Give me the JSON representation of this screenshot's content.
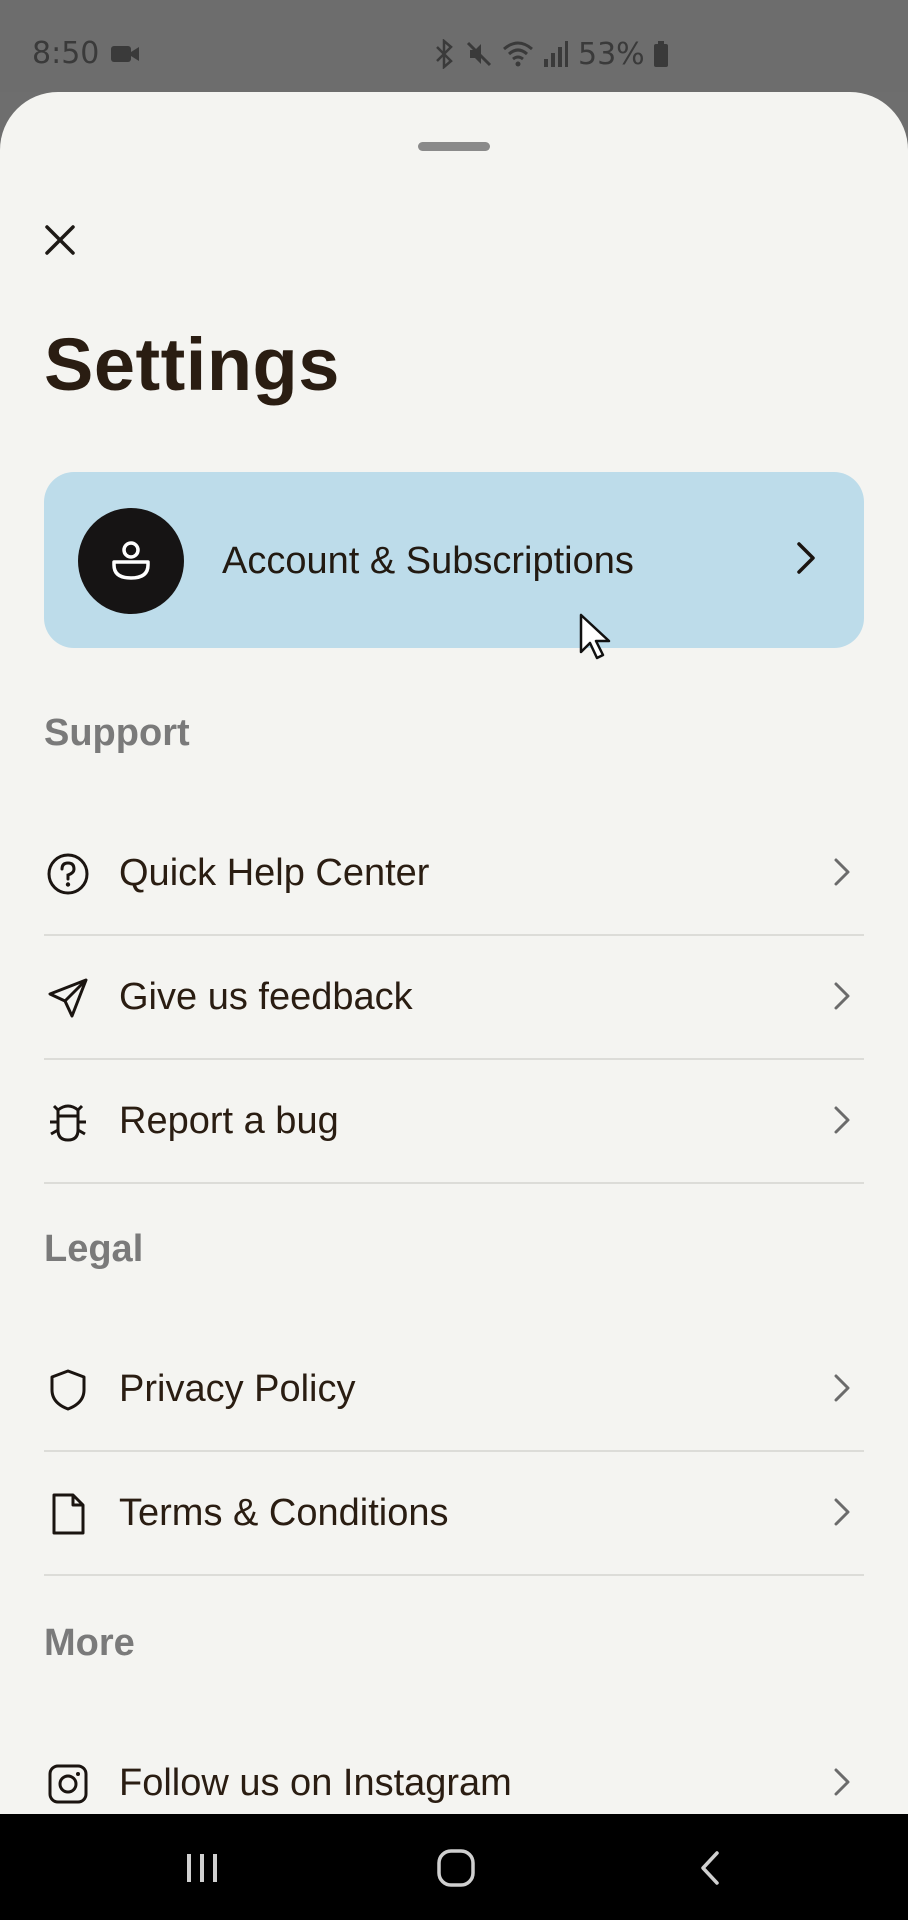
{
  "status_bar": {
    "time": "8:50",
    "battery_text": "53%",
    "icons": [
      "video-camera-icon",
      "bluetooth-icon",
      "mute-icon",
      "wifi-icon",
      "signal-icon",
      "battery-icon"
    ]
  },
  "header": {
    "title": "Settings"
  },
  "account": {
    "label": "Account & Subscriptions",
    "icon": "user-icon"
  },
  "sections": {
    "support": {
      "title": "Support",
      "items": [
        {
          "label": "Quick Help Center",
          "icon": "help-circle-icon"
        },
        {
          "label": "Give us feedback",
          "icon": "send-icon"
        },
        {
          "label": "Report a bug",
          "icon": "bug-icon"
        }
      ]
    },
    "legal": {
      "title": "Legal",
      "items": [
        {
          "label": "Privacy Policy",
          "icon": "shield-icon"
        },
        {
          "label": "Terms & Conditions",
          "icon": "document-icon"
        }
      ]
    },
    "more": {
      "title": "More",
      "items": [
        {
          "label": "Follow us on Instagram",
          "icon": "instagram-icon"
        }
      ]
    }
  },
  "colors": {
    "sheet_background": "#f4f4f1",
    "account_card": "#bddcea",
    "text_primary": "#2a1d12",
    "section_title": "#7a7a7a"
  }
}
